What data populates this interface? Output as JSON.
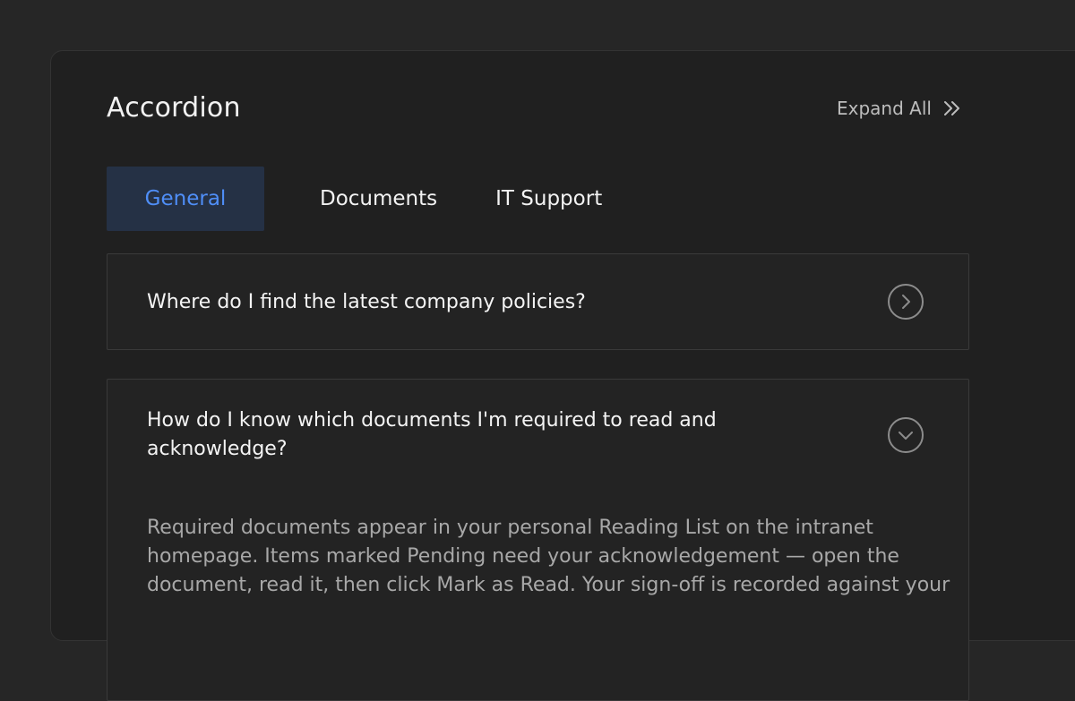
{
  "accordion": {
    "title": "Accordion",
    "expand_all_label": "Expand All",
    "tabs": [
      {
        "label": "General",
        "active": true
      },
      {
        "label": "Documents",
        "active": false
      },
      {
        "label": "IT Support",
        "active": false
      }
    ],
    "items": [
      {
        "question": "Where do I find the latest company policies?",
        "expanded": false,
        "toggle_icon": "chevron-right-circle-icon"
      },
      {
        "question": "How do I know which documents I'm required to read and acknowledge?",
        "expanded": true,
        "toggle_icon": "chevron-down-circle-icon",
        "answer": "Required documents appear in your personal Reading List on the intranet homepage. Items marked Pending need your acknowledgement — open the document, read it, then click Mark as Read. Your sign-off is recorded against your"
      }
    ]
  },
  "colors": {
    "page_background": "#262626",
    "panel_background": "#202020",
    "active_tab_background": "#253145",
    "active_tab_text": "#4f8ef7",
    "answer_text": "#a8a8a8"
  }
}
